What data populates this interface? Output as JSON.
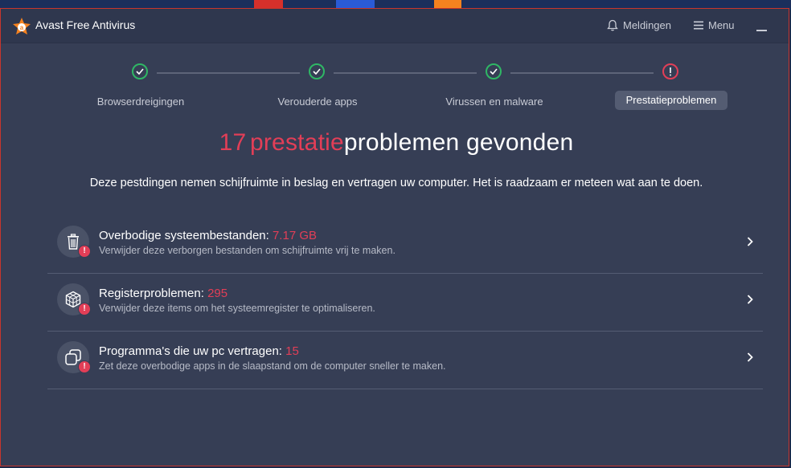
{
  "window": {
    "title": "Avast Free Antivirus"
  },
  "toolbar": {
    "notifications_label": "Meldingen",
    "menu_label": "Menu"
  },
  "steps": [
    {
      "label": "Browserdreigingen",
      "status": "ok"
    },
    {
      "label": "Verouderde apps",
      "status": "ok"
    },
    {
      "label": "Virussen en malware",
      "status": "ok"
    },
    {
      "label": "Prestatieproblemen",
      "status": "warning"
    }
  ],
  "headline": {
    "count": "17",
    "accent_word": "prestatie",
    "rest": "problemen gevonden"
  },
  "subtext": "Deze pestdingen nemen schijfruimte in beslag en vertragen uw computer. Het is raadzaam er meteen wat aan te doen.",
  "issues": [
    {
      "icon": "trash-icon",
      "title": "Overbodige systeembestanden:",
      "value": "7.17 GB",
      "description": "Verwijder deze verborgen bestanden om schijfruimte vrij te maken."
    },
    {
      "icon": "registry-cube-icon",
      "title": "Registerproblemen:",
      "value": "295",
      "description": "Verwijder deze items om het systeemregister te optimaliseren."
    },
    {
      "icon": "stacked-windows-icon",
      "title": "Programma's die uw pc vertragen:",
      "value": "15",
      "description": "Zet deze overbodige apps in de slaapstand om de computer sneller te maken."
    }
  ],
  "badge_mark": "!",
  "colors": {
    "accent": "#e23e57",
    "ok": "#2fb765",
    "brand_orange": "#f5821f",
    "background": "#363e55"
  }
}
